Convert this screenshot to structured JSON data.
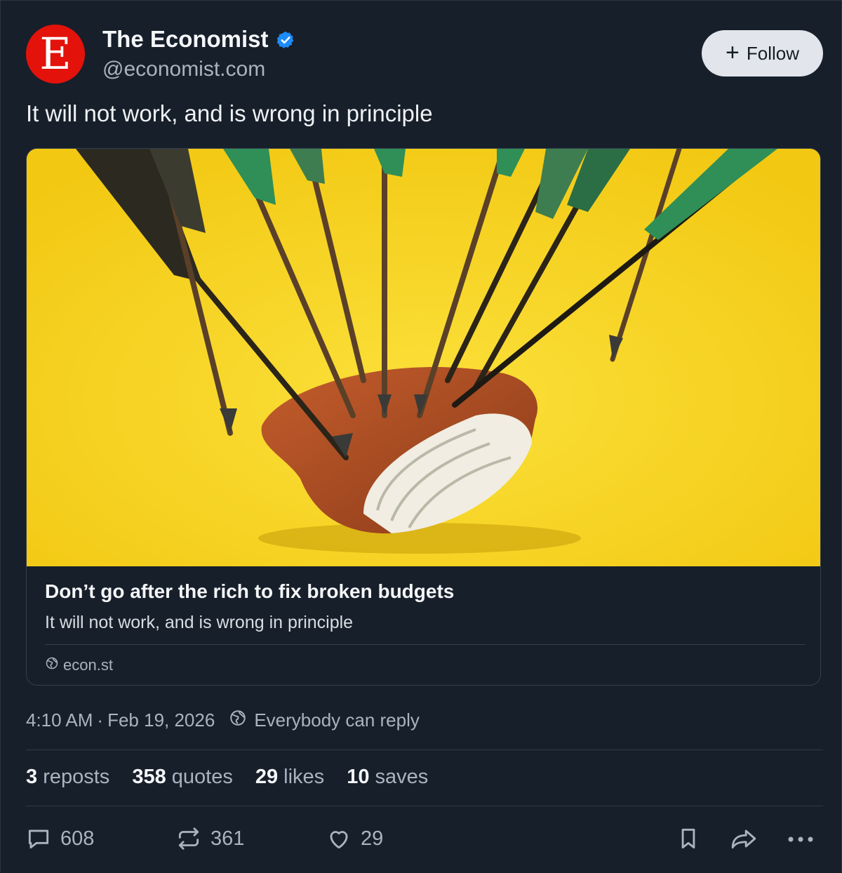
{
  "author": {
    "avatar_letter": "E",
    "name": "The Economist",
    "handle": "@economist.com",
    "verified": true
  },
  "follow_button": {
    "label": "Follow"
  },
  "post": {
    "text": "It will not work, and is wrong in principle"
  },
  "link_card": {
    "image_description_icon": "wallet-with-arrows-image",
    "title": "Don’t go after the rich to fix broken budgets",
    "description": "It will not work, and is wrong in principle",
    "domain": "econ.st"
  },
  "meta": {
    "time": "4:10 AM",
    "separator": "·",
    "date": "Feb 19, 2026",
    "reply_setting": "Everybody can reply"
  },
  "stats": {
    "reposts_count": "3",
    "reposts_label": "reposts",
    "quotes_count": "358",
    "quotes_label": "quotes",
    "likes_count": "29",
    "likes_label": "likes",
    "saves_count": "10",
    "saves_label": "saves"
  },
  "actions": {
    "reply_count": "608",
    "repost_count": "361",
    "like_count": "29"
  },
  "colors": {
    "background": "#171f2a",
    "avatar": "#e3120b",
    "verified": "#1d8cf8",
    "image_bg": "#f6d21a"
  }
}
